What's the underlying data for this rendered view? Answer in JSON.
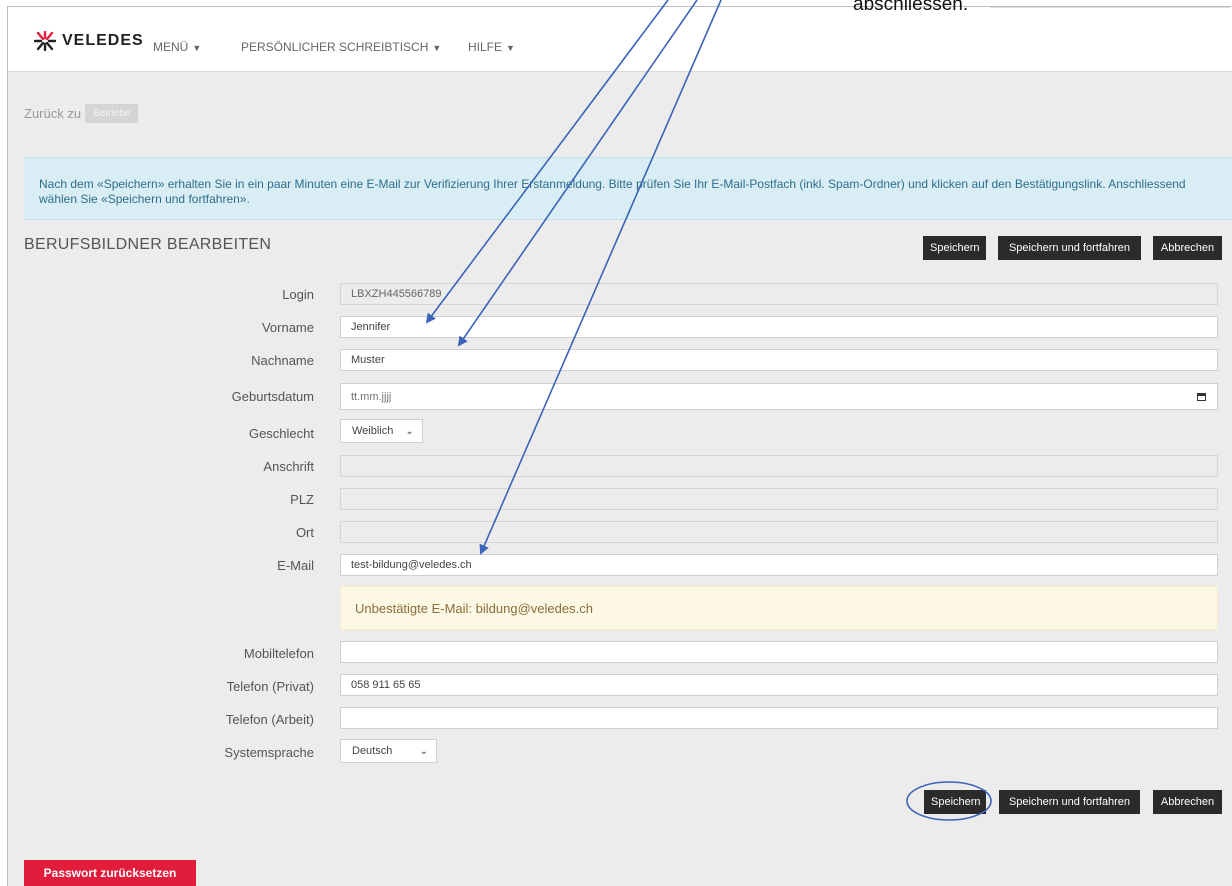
{
  "annotation": {
    "caption": "abschliessen."
  },
  "header": {
    "logo_text": "VELEDES",
    "nav": [
      {
        "label": "MENÜ"
      },
      {
        "label": "PERSÖNLICHER SCHREIBTISCH"
      },
      {
        "label": "HILFE"
      }
    ]
  },
  "breadcrumb": {
    "prefix": "Zurück zu",
    "link": "Betriebe"
  },
  "alert": {
    "text": "Nach dem «Speichern» erhalten Sie in ein paar Minuten eine E-Mail zur Verifizierung Ihrer Erstanmeldung. Bitte prüfen Sie Ihr E-Mail-Postfach (inkl. Spam-Ordner) und klicken auf den Bestätigungslink. Anschliessend wählen Sie «Speichern und fortfahren»."
  },
  "page": {
    "title": "BERUFSBILDNER BEARBEITEN"
  },
  "actions": {
    "save": "Speichern",
    "save_continue": "Speichern und fortfahren",
    "cancel": "Abbrechen"
  },
  "form": {
    "login": {
      "label": "Login",
      "value": "LBXZH445566789"
    },
    "vorname": {
      "label": "Vorname",
      "value": "Jennifer"
    },
    "nachname": {
      "label": "Nachname",
      "value": "Muster"
    },
    "geburtsdatum": {
      "label": "Geburtsdatum",
      "placeholder": "tt.mm.jjjj"
    },
    "geschlecht": {
      "label": "Geschlecht",
      "value": "Weiblich"
    },
    "anschrift": {
      "label": "Anschrift",
      "value": ""
    },
    "plz": {
      "label": "PLZ",
      "value": ""
    },
    "ort": {
      "label": "Ort",
      "value": ""
    },
    "email": {
      "label": "E-Mail",
      "value": "test-bildung@veledes.ch"
    },
    "email_warning": "Unbestätigte E-Mail: bildung@veledes.ch",
    "mobiltelefon": {
      "label": "Mobiltelefon",
      "value": ""
    },
    "telefon_privat": {
      "label": "Telefon (Privat)",
      "value": "058 911 65 65"
    },
    "telefon_arbeit": {
      "label": "Telefon (Arbeit)",
      "value": ""
    },
    "systemsprache": {
      "label": "Systemsprache",
      "value": "Deutsch"
    }
  },
  "reset": {
    "label": "Passwort zurücksetzen"
  },
  "colors": {
    "accent_red": "#e11d3b",
    "button_dark": "#2b2b2b",
    "info_bg": "#d9edf4",
    "warn_bg": "#fcf8e4",
    "annotation_blue": "#3b63b8"
  }
}
